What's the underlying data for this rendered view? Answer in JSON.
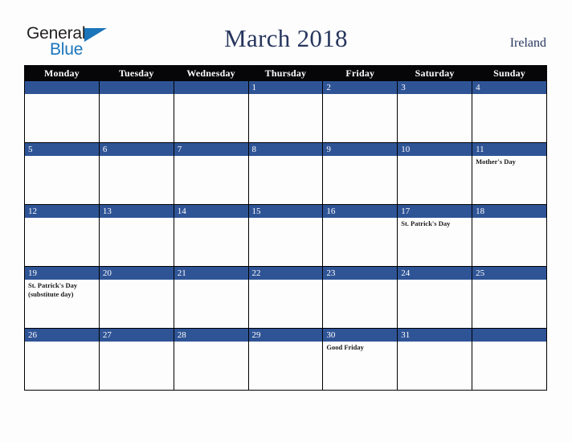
{
  "brand": {
    "name_part1": "General",
    "name_part2": "Blue",
    "triangle_icon": "blue-triangle-icon",
    "colors": {
      "dark_text": "#231f20",
      "blue": "#1b75bb"
    }
  },
  "header": {
    "title": "March 2018",
    "country": "Ireland",
    "title_color": "#27365e"
  },
  "calendar": {
    "colors": {
      "header_row_bg": "#060608",
      "header_row_text": "#ffffff",
      "day_bar_bg": "#2f5496",
      "day_bar_text": "#ffffff",
      "cell_bg": "#fdfdfd",
      "grid_line": "#000000",
      "page_bg": "#fdfdfd"
    },
    "weekday_headers": [
      "Monday",
      "Tuesday",
      "Wednesday",
      "Thursday",
      "Friday",
      "Saturday",
      "Sunday"
    ],
    "weeks": [
      [
        {
          "date": "",
          "events": []
        },
        {
          "date": "",
          "events": []
        },
        {
          "date": "",
          "events": []
        },
        {
          "date": "1",
          "events": []
        },
        {
          "date": "2",
          "events": []
        },
        {
          "date": "3",
          "events": []
        },
        {
          "date": "4",
          "events": []
        }
      ],
      [
        {
          "date": "5",
          "events": []
        },
        {
          "date": "6",
          "events": []
        },
        {
          "date": "7",
          "events": []
        },
        {
          "date": "8",
          "events": []
        },
        {
          "date": "9",
          "events": []
        },
        {
          "date": "10",
          "events": []
        },
        {
          "date": "11",
          "events": [
            "Mother's Day"
          ]
        }
      ],
      [
        {
          "date": "12",
          "events": []
        },
        {
          "date": "13",
          "events": []
        },
        {
          "date": "14",
          "events": []
        },
        {
          "date": "15",
          "events": []
        },
        {
          "date": "16",
          "events": []
        },
        {
          "date": "17",
          "events": [
            "St. Patrick's Day"
          ]
        },
        {
          "date": "18",
          "events": []
        }
      ],
      [
        {
          "date": "19",
          "events": [
            "St. Patrick's Day (substitute day)"
          ]
        },
        {
          "date": "20",
          "events": []
        },
        {
          "date": "21",
          "events": []
        },
        {
          "date": "22",
          "events": []
        },
        {
          "date": "23",
          "events": []
        },
        {
          "date": "24",
          "events": []
        },
        {
          "date": "25",
          "events": []
        }
      ],
      [
        {
          "date": "26",
          "events": []
        },
        {
          "date": "27",
          "events": []
        },
        {
          "date": "28",
          "events": []
        },
        {
          "date": "29",
          "events": []
        },
        {
          "date": "30",
          "events": [
            "Good Friday"
          ]
        },
        {
          "date": "31",
          "events": []
        },
        {
          "date": "",
          "events": []
        }
      ]
    ]
  }
}
